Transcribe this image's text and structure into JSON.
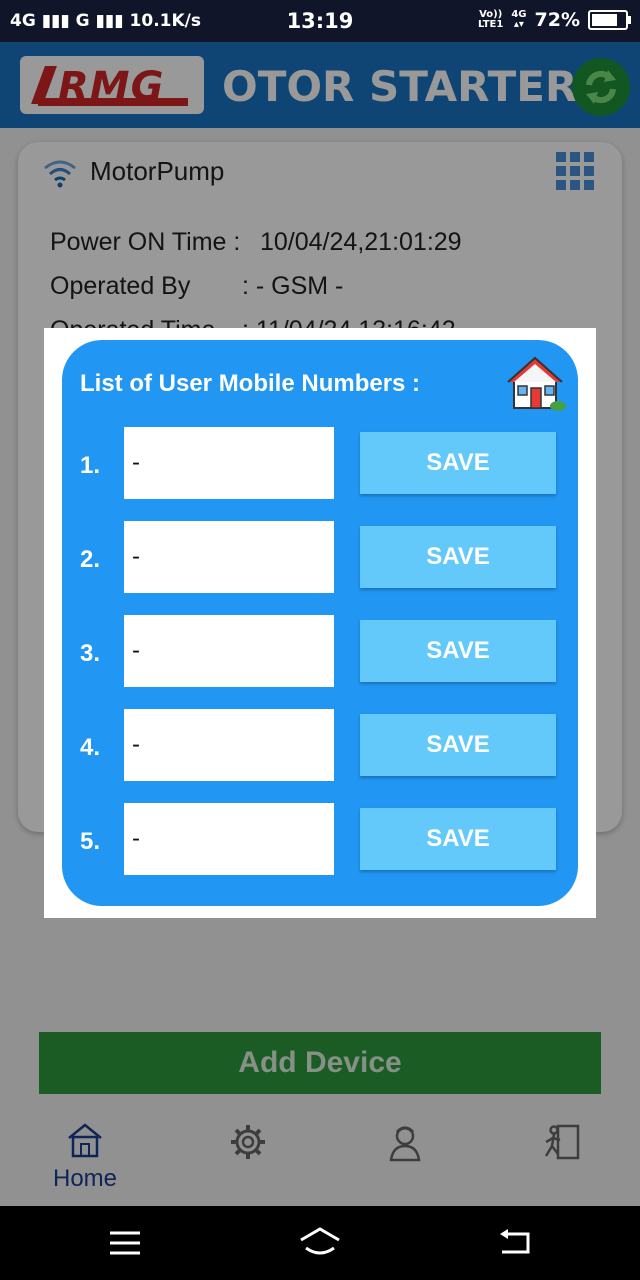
{
  "status_bar": {
    "left": "4G ▮▮▮ G ▮▮▮ 10.1K/s",
    "time": "13:19",
    "volte_top": "Vo))",
    "volte_bottom": "LTE1",
    "net_top": "4G",
    "net_bottom": "▴▾",
    "battery": "72%"
  },
  "app_bar": {
    "logo_text": "RMG",
    "title": "OTOR STARTER"
  },
  "device_card": {
    "name": "MotorPump",
    "rows": [
      {
        "label": "Power ON Time :",
        "value": "10/04/24,21:01:29"
      },
      {
        "label": "Operated By",
        "value": ":  - GSM -"
      },
      {
        "label": "Operated Time",
        "value": ":  11/04/24,13:16:42"
      }
    ]
  },
  "dialog": {
    "title": "List of User Mobile Numbers :",
    "entries": [
      {
        "index": "1.",
        "value": "-",
        "save": "SAVE"
      },
      {
        "index": "2.",
        "value": "-",
        "save": "SAVE"
      },
      {
        "index": "3.",
        "value": "-",
        "save": "SAVE"
      },
      {
        "index": "4.",
        "value": "-",
        "save": "SAVE"
      },
      {
        "index": "5.",
        "value": "-",
        "save": "SAVE"
      }
    ]
  },
  "add_device_label": "Add Device",
  "bottom_nav": {
    "home_label": "Home"
  },
  "colors": {
    "app_bar": "#1a73c4",
    "dialog_panel": "#2196f3",
    "save_button": "#63c8fa",
    "add_device": "#2e9a3e"
  },
  "icons": [
    "wifi-icon",
    "grid-menu-icon",
    "refresh-icon",
    "house-icon",
    "home-icon",
    "gear-icon",
    "user-icon",
    "exit-icon"
  ]
}
